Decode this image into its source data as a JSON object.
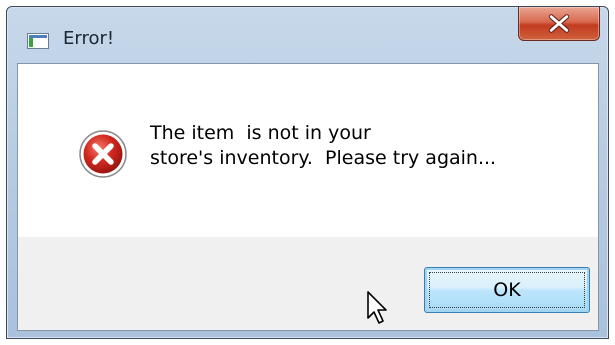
{
  "window": {
    "title": "Error!",
    "app_icon": "window-app-icon",
    "close_icon": "close-x-icon"
  },
  "dialog": {
    "icon": "error-icon",
    "message_line1": "The item  is not in your",
    "message_line2": "store's inventory.  Please try again...",
    "ok_label": "OK"
  },
  "colors": {
    "titlebar": "#b9cde3",
    "close_button": "#c23b21",
    "error_icon": "#c8231e",
    "footer": "#f0f0f0",
    "ok_border": "#3c7fb1"
  }
}
